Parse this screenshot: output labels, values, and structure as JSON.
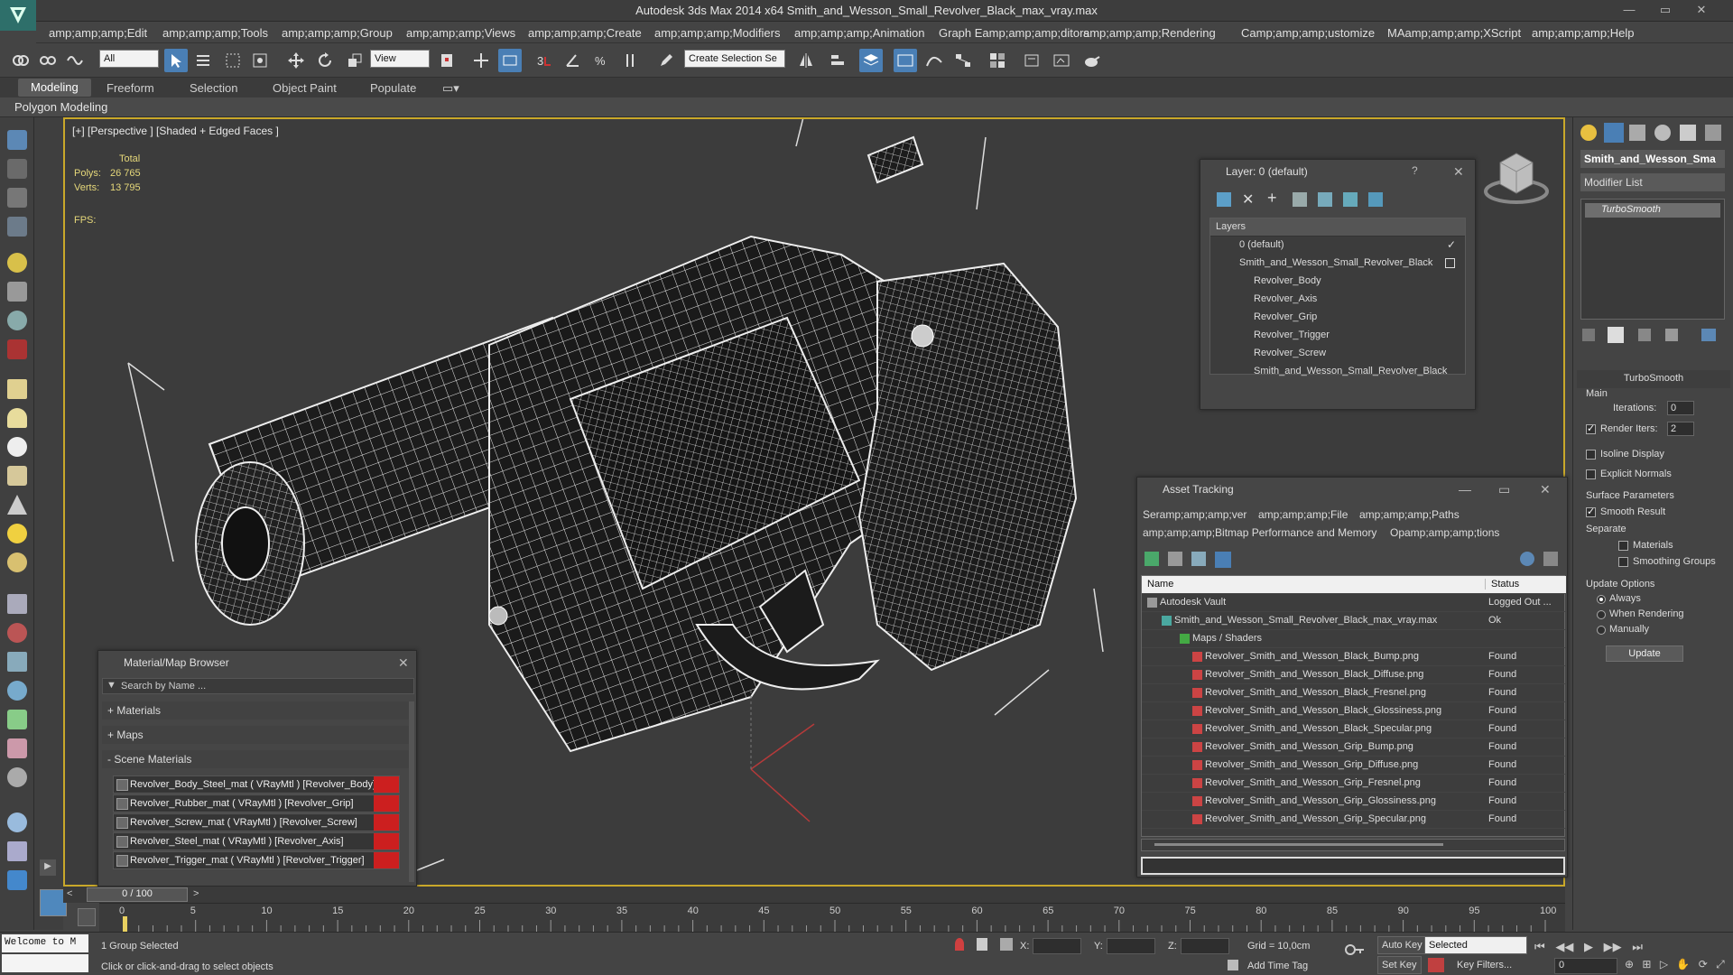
{
  "app": {
    "title": "Autodesk 3ds Max  2014 x64     Smith_and_Wesson_Small_Revolver_Black_max_vray.max"
  },
  "window_controls": [
    "—",
    "▭",
    "✕"
  ],
  "menu": [
    "amp;amp;amp;Edit",
    "amp;amp;amp;Tools",
    "amp;amp;amp;Group",
    "amp;amp;amp;Views",
    "amp;amp;amp;Create",
    "amp;amp;amp;Modifiers",
    "amp;amp;amp;Animation",
    "Graph Eamp;amp;amp;ditors",
    "amp;amp;amp;Rendering",
    "Camp;amp;amp;ustomize",
    "MAamp;amp;amp;XScript",
    "amp;amp;amp;Help"
  ],
  "toolbar": {
    "selection_filter": "All",
    "reference_coord": "View",
    "named_selection": "Create Selection Se"
  },
  "ribbon_tabs": [
    "Modeling",
    "Freeform",
    "Selection",
    "Object Paint",
    "Populate"
  ],
  "ribbon_panel": "Polygon Modeling",
  "viewport": {
    "label": "[+] [Perspective ] [Shaded + Edged Faces ]",
    "stats": {
      "total_label": "Total",
      "polys_label": "Polys:",
      "polys_value": "26 765",
      "verts_label": "Verts:",
      "verts_value": "13 795",
      "fps_label": "FPS:"
    },
    "accent": "#c9a82a"
  },
  "layer_panel": {
    "title": "Layer: 0 (default)",
    "help": "?",
    "close": "✕",
    "header": "Layers",
    "items": [
      {
        "label": "0 (default)"
      },
      {
        "label": "Smith_and_Wesson_Small_Revolver_Black"
      },
      {
        "label": "Revolver_Body"
      },
      {
        "label": "Revolver_Axis"
      },
      {
        "label": "Revolver_Grip"
      },
      {
        "label": "Revolver_Trigger"
      },
      {
        "label": "Revolver_Screw"
      },
      {
        "label": "Smith_and_Wesson_Small_Revolver_Black"
      }
    ]
  },
  "asset_tracking": {
    "title": "Asset Tracking",
    "menu": [
      "Seramp;amp;amp;ver",
      "amp;amp;amp;File",
      "amp;amp;amp;Paths",
      "amp;amp;amp;Bitmap Performance and Memory",
      "Opamp;amp;amp;tions"
    ],
    "columns": [
      "Name",
      "Status"
    ],
    "rows": [
      {
        "name": "Autodesk Vault",
        "status": "Logged Out ..."
      },
      {
        "name": "Smith_and_Wesson_Small_Revolver_Black_max_vray.max",
        "status": "Ok"
      },
      {
        "name": "Maps / Shaders",
        "status": ""
      },
      {
        "name": "Revolver_Smith_and_Wesson_Black_Bump.png",
        "status": "Found"
      },
      {
        "name": "Revolver_Smith_and_Wesson_Black_Diffuse.png",
        "status": "Found"
      },
      {
        "name": "Revolver_Smith_and_Wesson_Black_Fresnel.png",
        "status": "Found"
      },
      {
        "name": "Revolver_Smith_and_Wesson_Black_Glossiness.png",
        "status": "Found"
      },
      {
        "name": "Revolver_Smith_and_Wesson_Black_Specular.png",
        "status": "Found"
      },
      {
        "name": "Revolver_Smith_and_Wesson_Grip_Bump.png",
        "status": "Found"
      },
      {
        "name": "Revolver_Smith_and_Wesson_Grip_Diffuse.png",
        "status": "Found"
      },
      {
        "name": "Revolver_Smith_and_Wesson_Grip_Fresnel.png",
        "status": "Found"
      },
      {
        "name": "Revolver_Smith_and_Wesson_Grip_Glossiness.png",
        "status": "Found"
      },
      {
        "name": "Revolver_Smith_and_Wesson_Grip_Specular.png",
        "status": "Found"
      }
    ]
  },
  "material_browser": {
    "title": "Material/Map Browser",
    "search_placeholder": "Search by Name ...",
    "sections": [
      "+ Materials",
      "+ Maps",
      "- Scene Materials"
    ],
    "materials": [
      "Revolver_Body_Steel_mat ( VRayMtl ) [Revolver_Body]",
      "Revolver_Rubber_mat ( VRayMtl ) [Revolver_Grip]",
      "Revolver_Screw_mat ( VRayMtl ) [Revolver_Screw]",
      "Revolver_Steel_mat ( VRayMtl ) [Revolver_Axis]",
      "Revolver_Trigger_mat ( VRayMtl ) [Revolver_Trigger]"
    ]
  },
  "command_panel": {
    "object_name": "Smith_and_Wesson_Sma",
    "modifier_list": "Modifier List",
    "stack_item": "TurboSmooth",
    "rollout_title": "TurboSmooth",
    "main_label": "Main",
    "iterations_label": "Iterations:",
    "iterations_value": "0",
    "render_iters_label": "Render Iters:",
    "render_iters_value": "2",
    "isoline_label": "Isoline Display",
    "explicit_label": "Explicit Normals",
    "surface_label": "Surface Parameters",
    "smooth_result_label": "Smooth Result",
    "separate_label": "Separate",
    "materials_label": "Materials",
    "smoothing_label": "Smoothing Groups",
    "update_options_label": "Update Options",
    "always_label": "Always",
    "when_rendering_label": "When Rendering",
    "manually_label": "Manually",
    "update_button": "Update"
  },
  "timeline": {
    "frame_counter": "0 / 100",
    "prev": "<",
    "next": ">",
    "ticks": [
      "0",
      "5",
      "10",
      "15",
      "20",
      "25",
      "30",
      "35",
      "40",
      "45",
      "50",
      "55",
      "60",
      "65",
      "70",
      "75",
      "80",
      "85",
      "90",
      "95",
      "100"
    ]
  },
  "status": {
    "welcome": "Welcome to M",
    "selection": "1 Group Selected",
    "prompt": "Click or click-and-drag to select objects",
    "x_label": "X:",
    "y_label": "Y:",
    "z_label": "Z:",
    "grid": "Grid = 10,0cm",
    "add_time_tag": "Add Time Tag",
    "auto_key": "Auto Key",
    "set_key": "Set Key",
    "selected_dropdown": "Selected",
    "key_filters": "Key Filters...",
    "frame_value": "0"
  }
}
